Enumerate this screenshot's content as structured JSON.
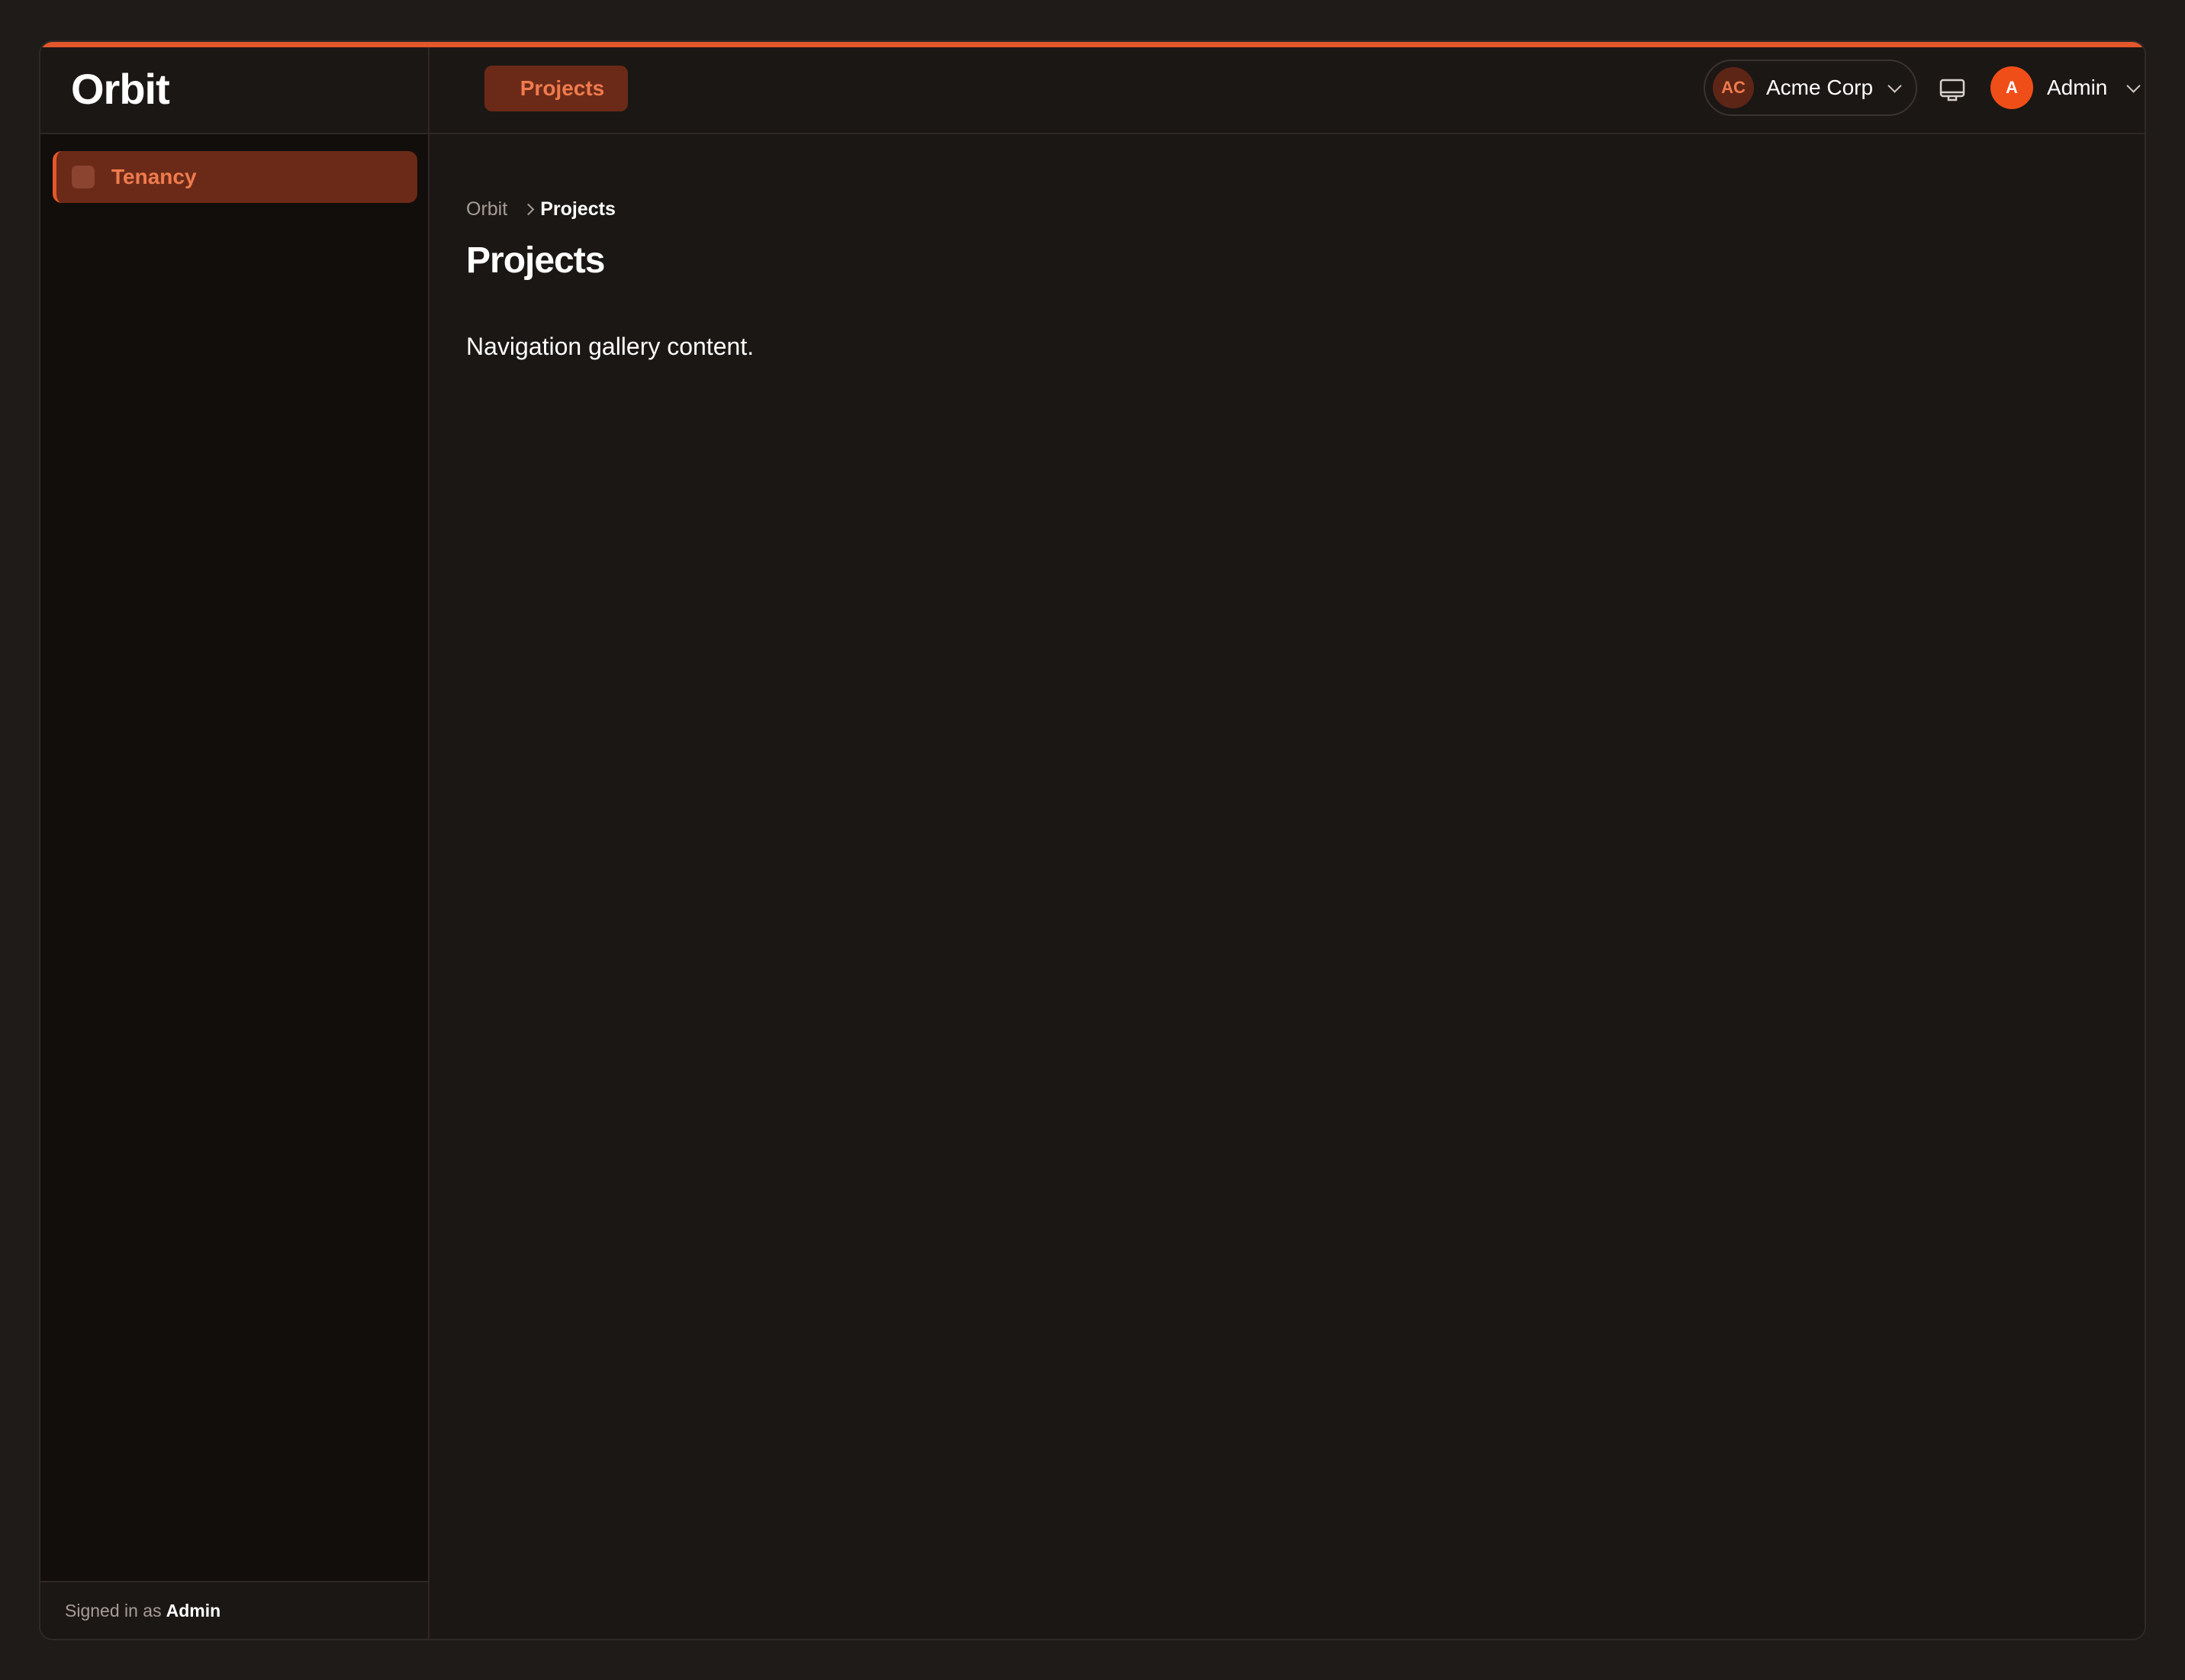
{
  "app": {
    "name": "Orbit"
  },
  "theme": {
    "accent": "#e3572a",
    "background": "#1b1715",
    "sidebar_background": "#120e0c"
  },
  "sidebar": {
    "items": [
      {
        "label": "Tenancy",
        "active": true
      }
    ],
    "footer": {
      "prefix": "Signed in as",
      "user": "Admin"
    }
  },
  "topbar": {
    "tabs": [
      {
        "label": "Projects",
        "active": true
      }
    ],
    "org_switcher": {
      "initials": "AC",
      "name": "Acme Corp",
      "icon": "chevron-down-icon"
    },
    "display_icon": "monitor-icon",
    "user_menu": {
      "initial": "A",
      "name": "Admin",
      "icon": "chevron-down-icon"
    }
  },
  "breadcrumb": {
    "root": "Orbit",
    "current": "Projects",
    "separator_icon": "chevron-right-icon"
  },
  "page": {
    "title": "Projects",
    "content": "Navigation gallery content."
  }
}
